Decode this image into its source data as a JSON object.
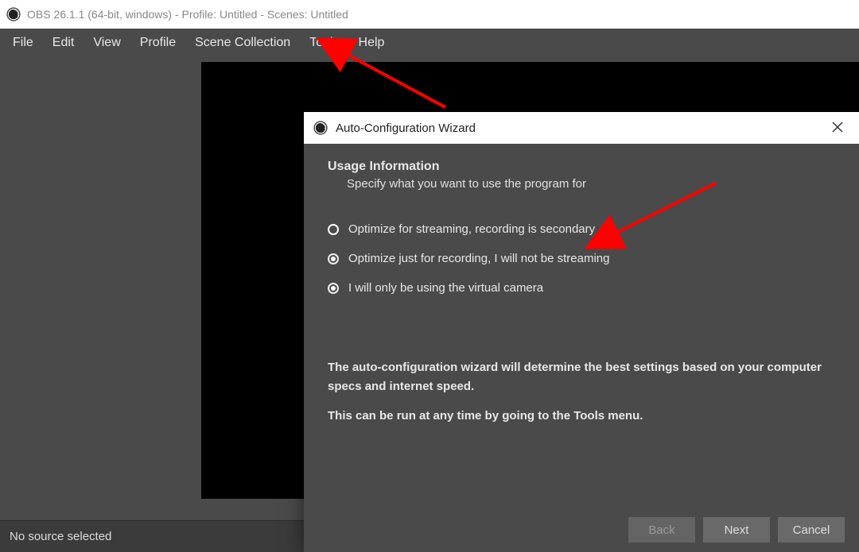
{
  "window": {
    "title": "OBS 26.1.1 (64-bit, windows) - Profile: Untitled - Scenes: Untitled"
  },
  "menubar": {
    "items": [
      "File",
      "Edit",
      "View",
      "Profile",
      "Scene Collection",
      "Tools",
      "Help"
    ]
  },
  "statusbar": {
    "text": "No source selected"
  },
  "wizard": {
    "title": "Auto-Configuration Wizard",
    "heading": "Usage Information",
    "subheading": "Specify what you want to use the program for",
    "options": [
      {
        "label": "Optimize for streaming, recording is secondary",
        "selected": true
      },
      {
        "label": "Optimize just for recording, I will not be streaming",
        "selected": false
      },
      {
        "label": "I will only be using the virtual camera",
        "selected": false
      }
    ],
    "description1": "The auto-configuration wizard will determine the best settings based on your computer specs and internet speed.",
    "description2": "This can be run at any time by going to the Tools menu.",
    "buttons": {
      "back": "Back",
      "next": "Next",
      "cancel": "Cancel"
    }
  }
}
